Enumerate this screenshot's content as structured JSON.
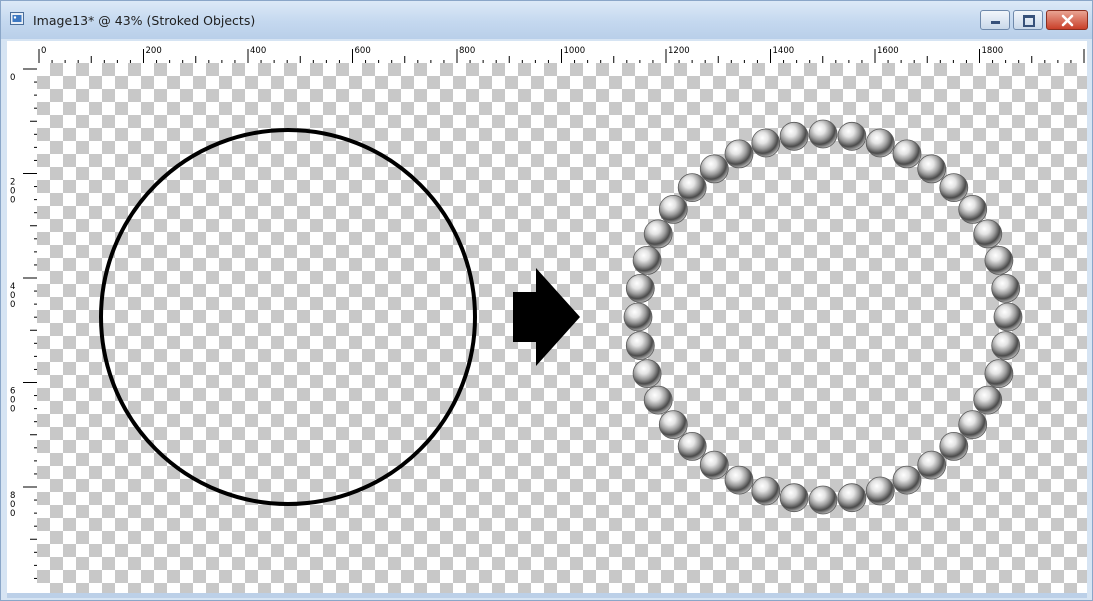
{
  "window": {
    "title": "Image13* @  43% (Stroked Objects)",
    "minimize_icon": "minimize-icon",
    "maximize_icon": "maximize-icon",
    "close_icon": "close-icon"
  },
  "ruler": {
    "top_labels": [
      "0",
      "200",
      "400",
      "600",
      "800",
      "1000",
      "1200",
      "1400",
      "1600",
      "1800"
    ],
    "left_labels": [
      "0",
      "200",
      "400",
      "600",
      "800"
    ]
  },
  "canvas": {
    "left_object": "stroked-circle",
    "arrow_icon": "right-arrow-icon",
    "right_object": "bead-circle"
  },
  "colors": {
    "title_bar": "#c4d8ef",
    "close_button": "#c9402a",
    "stroke": "#000000",
    "checker": "#c8c8c8"
  }
}
